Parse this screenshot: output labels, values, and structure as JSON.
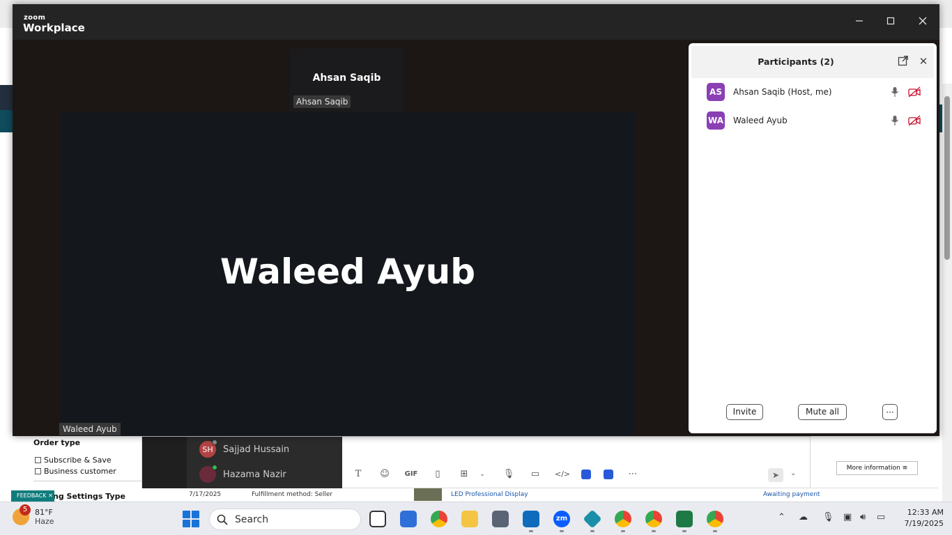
{
  "zoom": {
    "brand_small": "zoom",
    "brand_big": "Workplace",
    "strip_tile_name": "Ahsan Saqib",
    "strip_tile_label": "Ahsan Saqib",
    "main_tile_name": "Waleed Ayub",
    "main_tile_label": "Waleed Ayub",
    "panel": {
      "title": "Participants (2)",
      "participants": [
        {
          "initials": "AS",
          "name": "Ahsan Saqib (Host, me)"
        },
        {
          "initials": "WA",
          "name": "Waleed Ayub"
        }
      ],
      "invite_label": "Invite",
      "mute_all_label": "Mute all",
      "more_label": "···"
    }
  },
  "chat": {
    "items": [
      {
        "initials": "SH",
        "name": "Sajjad Hussain"
      },
      {
        "initials": "",
        "name": "Hazama Nazir"
      }
    ],
    "gif_label": "GIF"
  },
  "background_page": {
    "filter_heading": "Order type",
    "checkbox_1": "Subscribe & Save",
    "checkbox_2": "Business customer",
    "settings_heading_partial": "ng Settings Type",
    "feedback_label": "FEEDBACK",
    "row_date": "7/17/2025",
    "row_fulfillment": "Fulfillment method: Seller",
    "row_product": "LED Professional Display",
    "row_status": "Awaiting payment",
    "more_info": "More information"
  },
  "taskbar": {
    "weather_badge": "5",
    "temperature": "81°F",
    "condition": "Haze",
    "search_placeholder": "Search",
    "time": "12:33 AM",
    "date": "7/19/2025",
    "zoom_app_label": "zm"
  },
  "colors": {
    "participant_avatar": "#8a3fb5",
    "video_off_red": "#c8102e",
    "windows_blue": "#1a73d9"
  }
}
